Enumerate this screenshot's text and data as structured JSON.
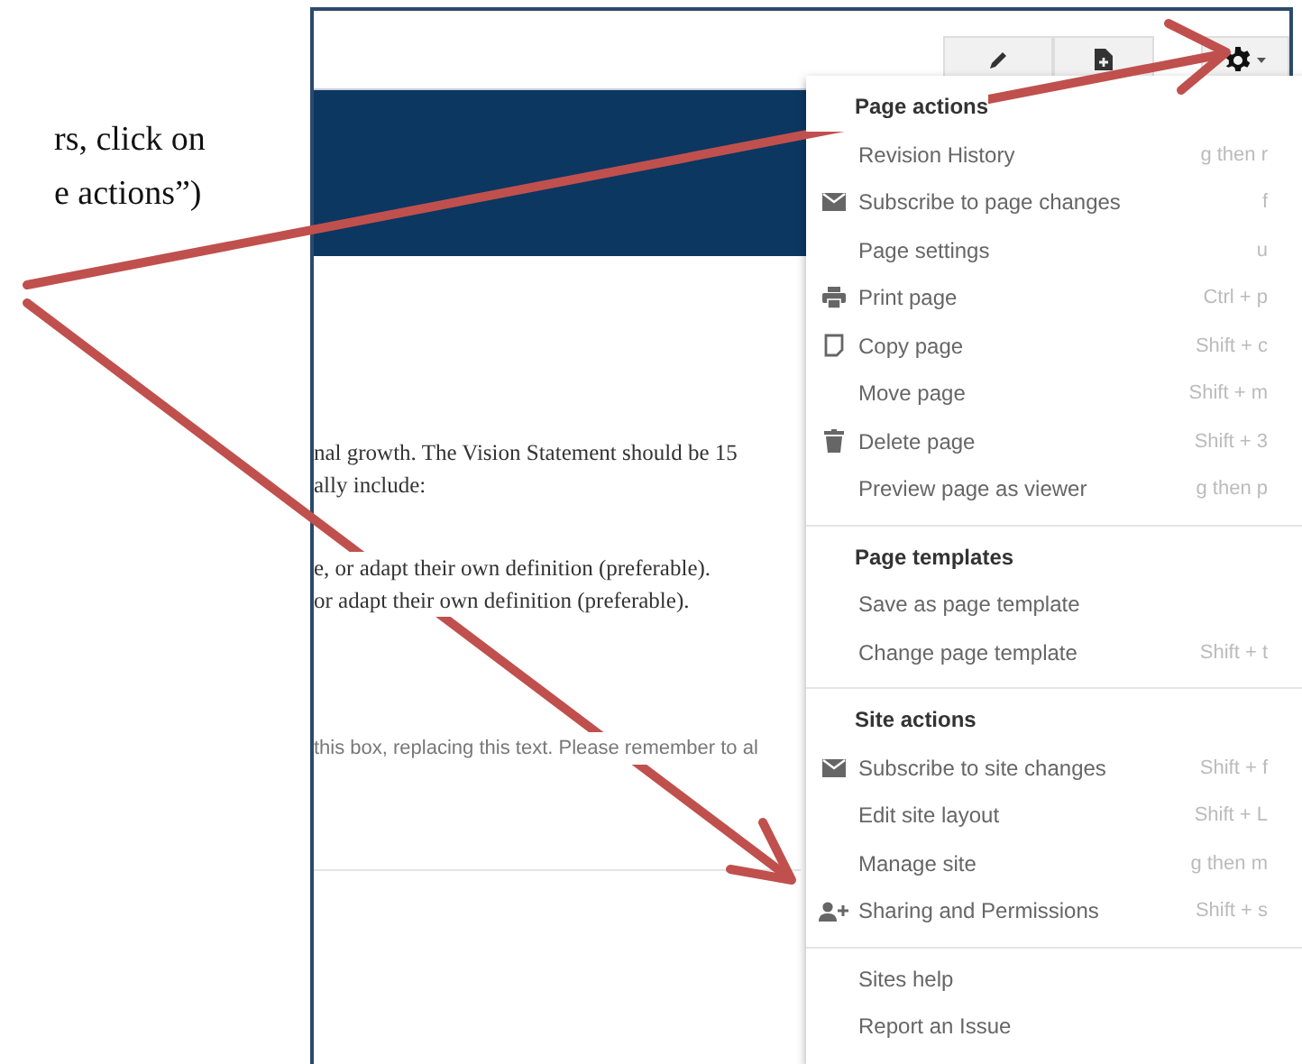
{
  "caption_lines": [
    "rs, click on",
    "e actions”)"
  ],
  "document": {
    "lines": [
      {
        "text": "nal growth. The Vision Statement should be 15",
        "kind": "serif"
      },
      {
        "text": "ally include:",
        "kind": "serif"
      },
      {
        "text": "e, or adapt their own definition (preferable).",
        "kind": "serif"
      },
      {
        "text": "or adapt their own definition (preferable).",
        "kind": "serif"
      },
      {
        "text": "this box, replacing this text. Please remember to al",
        "kind": "note"
      }
    ]
  },
  "menu": {
    "sections": [
      {
        "header": "Page actions",
        "items": [
          {
            "label": "Revision History",
            "shortcut": "g then r",
            "kind": "plain"
          },
          {
            "label": "Subscribe to page changes",
            "shortcut": "f",
            "kind": "mail"
          },
          {
            "label": "Page settings",
            "shortcut": "u",
            "kind": "plain"
          },
          {
            "label": "Print page",
            "shortcut": "Ctrl + p",
            "kind": "print"
          },
          {
            "label": "Copy page",
            "shortcut": "Shift + c",
            "kind": "copy"
          },
          {
            "label": "Move page",
            "shortcut": "Shift + m",
            "kind": "plain"
          },
          {
            "label": "Delete page",
            "shortcut": "Shift + 3",
            "kind": "trash"
          },
          {
            "label": "Preview page as viewer",
            "shortcut": "g then p",
            "kind": "plain"
          }
        ]
      },
      {
        "header": "Page templates",
        "items": [
          {
            "label": "Save as page template",
            "kind": "plain"
          },
          {
            "label": "Change page template",
            "shortcut": "Shift + t",
            "kind": "plain"
          }
        ]
      },
      {
        "header": "Site actions",
        "items": [
          {
            "label": "Subscribe to site changes",
            "shortcut": "Shift + f",
            "kind": "mail"
          },
          {
            "label": "Edit site layout",
            "shortcut": "Shift + L",
            "kind": "plain"
          },
          {
            "label": "Manage site",
            "shortcut": "g then m",
            "kind": "plain"
          },
          {
            "label": "Sharing and Permissions",
            "shortcut": "Shift + s",
            "kind": "person-add"
          }
        ]
      },
      {
        "items": [
          {
            "label": "Sites help",
            "kind": "plain"
          },
          {
            "label": "Report an Issue",
            "kind": "plain"
          }
        ]
      }
    ]
  }
}
